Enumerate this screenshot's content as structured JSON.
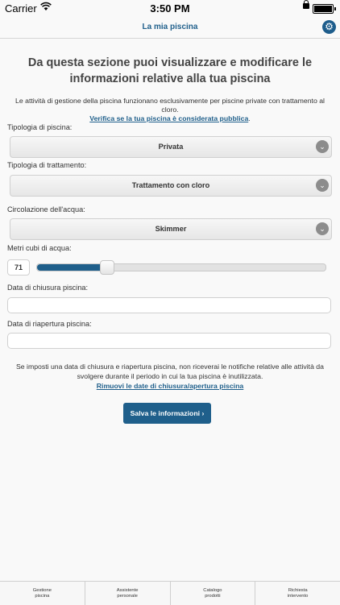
{
  "status_bar": {
    "carrier": "Carrier",
    "time": "3:50 PM"
  },
  "nav": {
    "title": "La mia piscina",
    "settings_icon": "gear-icon"
  },
  "page": {
    "headline": "Da questa sezione puoi visualizzare e modificare le informazioni relative alla tua piscina",
    "intro": "Le attività di gestione della piscina funzionano esclusivamente per piscine private con trattamento al cloro.",
    "intro_link": "Verifica se la tua piscina è considerata pubblica",
    "intro_link_suffix": "."
  },
  "form": {
    "pool_type": {
      "label": "Tipologia di piscina:",
      "value": "Privata"
    },
    "treatment_type": {
      "label": "Tipologia di trattamento:",
      "value": "Trattamento con cloro"
    },
    "water_circulation": {
      "label": "Circolazione dell'acqua:",
      "value": "Skimmer"
    },
    "water_volume": {
      "label": "Metri cubi di acqua:",
      "value": "71",
      "fill_fraction": 0.24
    },
    "closing_date": {
      "label": "Data di chiusura piscina:",
      "value": ""
    },
    "reopening_date": {
      "label": "Data di riapertura piscina:",
      "value": ""
    }
  },
  "note": {
    "text": "Se imposti una data di chiusura e riapertura piscina, non riceverai le notifiche relative alle attività da svolgere durante il periodo in cui la tua piscina è inutilizzata.",
    "link": "Rimuovi le date di chiusura/apertura piscina"
  },
  "save_button": {
    "label": "Salva le informazioni ›"
  },
  "tab_bar": {
    "tabs": [
      {
        "label": "Gestione\npiscina"
      },
      {
        "label": "Assistente\npersonale"
      },
      {
        "label": "Catalogo\nprodotti"
      },
      {
        "label": "Richiesta\nintervento"
      }
    ]
  },
  "colors": {
    "accent": "#1f5f8b",
    "background": "#f9f9f9"
  }
}
